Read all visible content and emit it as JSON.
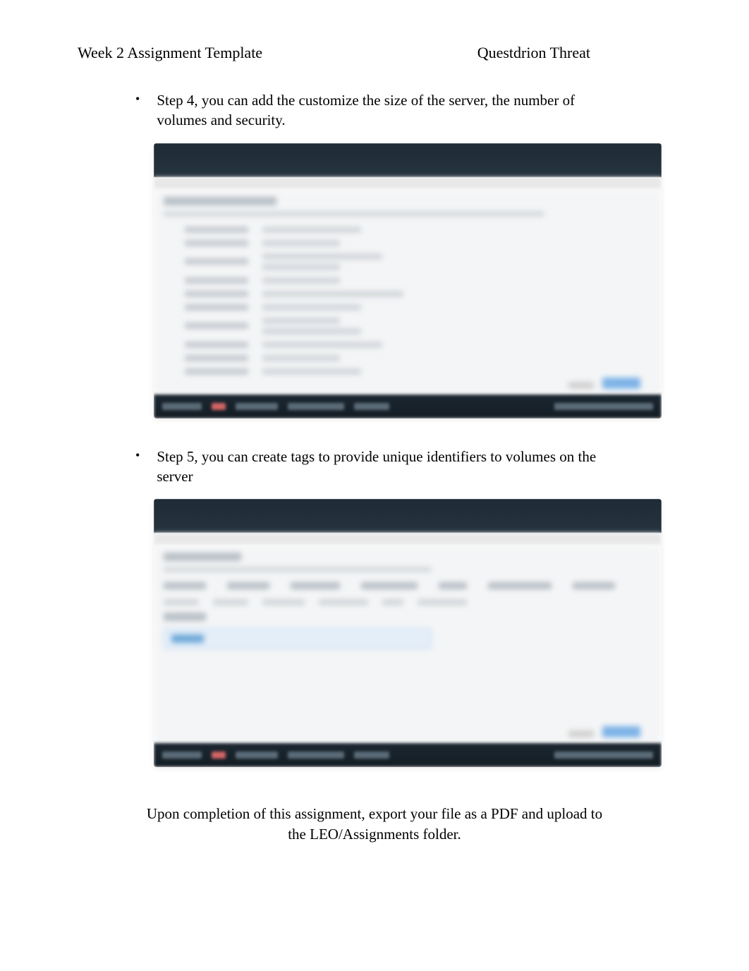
{
  "header": {
    "left": "Week 2 Assignment Template",
    "right": "Questdrion Threat"
  },
  "bullets": [
    {
      "text": "Step 4, you can add the customize the size of the server, the number of volumes and security."
    },
    {
      "text": "Step 5, you can create tags to provide unique identifiers to volumes on the server"
    }
  ],
  "footer": "Upon completion of this assignment, export your file as a PDF and upload to the LEO/Assignments folder."
}
